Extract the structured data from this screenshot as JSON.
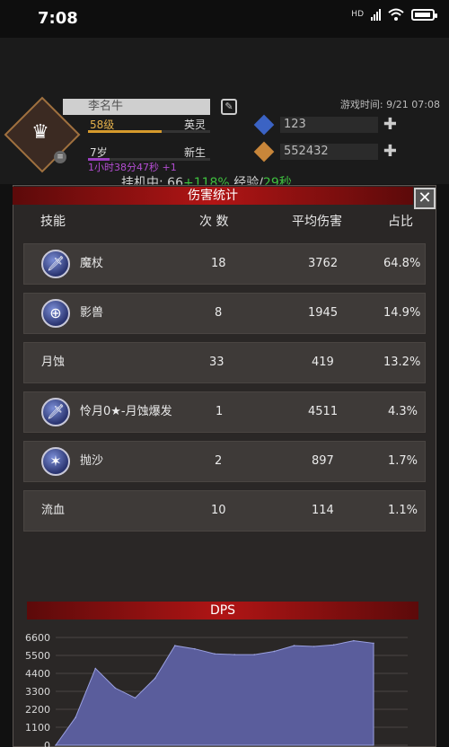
{
  "status_bar": {
    "time": "7:08",
    "signal_label": "HD"
  },
  "character": {
    "name": "李名牛",
    "level": "58级",
    "rank": "英灵",
    "age": "7岁",
    "status": "新生",
    "time_bonus": "1小时38分47秒 +1",
    "game_time": "游戏时间: 9/21 07:08",
    "resource_1": "123",
    "resource_2": "552432",
    "afk_prefix": "挂机中: 66",
    "afk_bonus": "+118%",
    "afk_exp_label": " 经验/",
    "afk_rate": "29秒"
  },
  "dialog": {
    "title": "伤害统计",
    "close": "✕",
    "headers": {
      "skill": "技能",
      "count": "次 数",
      "avg": "平均伤害",
      "ratio": "占比"
    },
    "rows": [
      {
        "name": "魔杖",
        "count": "18",
        "avg": "3762",
        "ratio": "64.8%",
        "icon": "sword-icon"
      },
      {
        "name": "影兽",
        "count": "8",
        "avg": "1945",
        "ratio": "14.9%",
        "icon": "beast-icon"
      },
      {
        "name": "月蚀",
        "count": "33",
        "avg": "419",
        "ratio": "13.2%",
        "icon": ""
      },
      {
        "name": "怜月0★-月蚀爆发",
        "count": "1",
        "avg": "4511",
        "ratio": "4.3%",
        "icon": "sword-icon"
      },
      {
        "name": "抛沙",
        "count": "2",
        "avg": "897",
        "ratio": "1.7%",
        "icon": "claw-icon"
      },
      {
        "name": "流血",
        "count": "10",
        "avg": "114",
        "ratio": "1.1%",
        "icon": ""
      }
    ]
  },
  "chart_data": {
    "type": "area",
    "title": "DPS",
    "yticks": [
      "6600",
      "5500",
      "4400",
      "3300",
      "2200",
      "1100",
      "0"
    ],
    "ylim": [
      0,
      6600
    ],
    "values": [
      0,
      1700,
      4700,
      3500,
      2900,
      4100,
      6100,
      5900,
      5600,
      5550,
      5550,
      5750,
      6100,
      6050,
      6150,
      6400,
      6250
    ],
    "color": "#5a5d9c",
    "grid": true
  },
  "colors": {
    "accent_red": "#b01515",
    "green": "#3fbf3f",
    "gold": "#e3b04b",
    "purple": "#b24dd0"
  }
}
